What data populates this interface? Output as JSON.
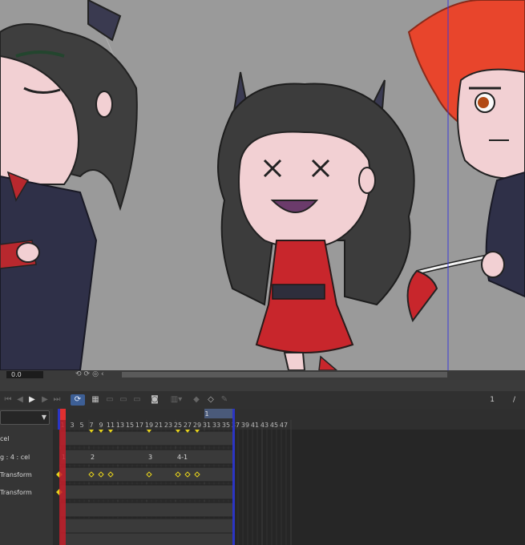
{
  "canvas": {
    "background_color": "#9a9a9a"
  },
  "status_bar": {
    "zoom_value": "0.0",
    "icons": [
      "undo-icon",
      "redo-icon",
      "reset-icon",
      "chevron-left-icon"
    ]
  },
  "toolbar": {
    "buttons": [
      "first-frame",
      "previous-frame",
      "play",
      "next-frame",
      "last-frame",
      "loop",
      "new-animation-cel",
      "specify-cel",
      "delete-cel",
      "enable-onion-skin",
      "add-keyframe",
      "keyframe-interpolation",
      "apply-easing",
      "pencil"
    ],
    "frame_counter": "1",
    "frame_separator": "/"
  },
  "layers": [
    {
      "label": "cel"
    },
    {
      "label": "g : 4 : cel"
    },
    {
      "label": "Transform"
    },
    {
      "label": "Transform"
    }
  ],
  "timeline": {
    "ruler_labels": [
      1,
      3,
      5,
      7,
      9,
      11,
      13,
      15,
      17,
      19,
      21,
      23,
      25,
      27,
      29,
      31,
      33,
      35,
      37,
      39,
      41,
      43,
      45,
      47
    ],
    "second_marker": "1",
    "cel_labels": [
      "1",
      "2",
      "3",
      "4-1"
    ],
    "keyframes_row1": [
      7,
      9,
      11,
      19,
      25,
      27,
      29
    ],
    "keyframes_row2": [
      1
    ],
    "colors": {
      "playhead": "#c41e2a",
      "end_marker": "#2b35c4",
      "keyframe": "#e6d21c",
      "selection": "#4a68b0"
    }
  }
}
